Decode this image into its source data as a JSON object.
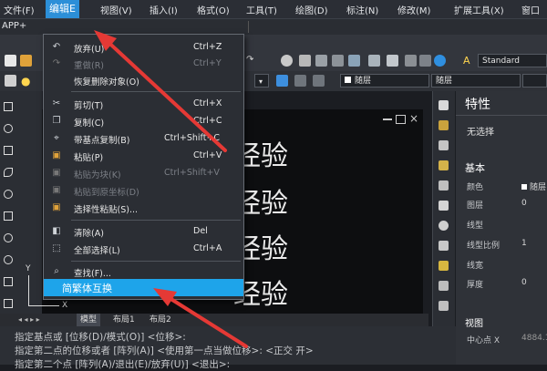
{
  "menubar": {
    "items": [
      "文件(F)",
      "编辑E",
      "视图(V)",
      "插入(I)",
      "格式(O)",
      "工具(T)",
      "绘图(D)",
      "标注(N)",
      "修改(M)",
      "扩展工具(X)",
      "窗口"
    ]
  },
  "app_label": "APP+",
  "toolbar": {
    "text_style": "Standard",
    "layer": "随层",
    "linetype": "随层"
  },
  "edit_menu": {
    "items": [
      {
        "label": "放弃(U)",
        "shortcut": "Ctrl+Z",
        "icon": "undo-icon",
        "disabled": false
      },
      {
        "label": "重做(R)",
        "shortcut": "Ctrl+Y",
        "icon": "redo-icon",
        "disabled": true
      },
      {
        "label": "恢复删除对象(O)",
        "shortcut": "",
        "icon": "",
        "disabled": false
      },
      {
        "label": "剪切(T)",
        "shortcut": "Ctrl+X",
        "icon": "scissors-icon",
        "disabled": false
      },
      {
        "label": "复制(C)",
        "shortcut": "Ctrl+C",
        "icon": "copy-icon",
        "disabled": false
      },
      {
        "label": "带基点复制(B)",
        "shortcut": "Ctrl+Shift+C",
        "icon": "copy-base-icon",
        "disabled": false
      },
      {
        "label": "粘贴(P)",
        "shortcut": "Ctrl+V",
        "icon": "paste-icon",
        "disabled": false
      },
      {
        "label": "粘贴为块(K)",
        "shortcut": "Ctrl+Shift+V",
        "icon": "paste-block-icon",
        "disabled": true
      },
      {
        "label": "粘贴到原坐标(D)",
        "shortcut": "",
        "icon": "paste-original-icon",
        "disabled": true
      },
      {
        "label": "选择性粘贴(S)...",
        "shortcut": "",
        "icon": "paste-special-icon",
        "disabled": false
      },
      {
        "label": "清除(A)",
        "shortcut": "Del",
        "icon": "eraser-icon",
        "disabled": false
      },
      {
        "label": "全部选择(L)",
        "shortcut": "Ctrl+A",
        "icon": "select-all-icon",
        "disabled": false
      },
      {
        "label": "查找(F)...",
        "shortcut": "",
        "icon": "find-icon",
        "disabled": false
      },
      {
        "label": "简繁体互换",
        "shortcut": "",
        "icon": "",
        "disabled": false
      }
    ]
  },
  "canvas": {
    "texts": [
      "经验",
      "经验",
      "经验",
      "经验"
    ]
  },
  "layout_tabs": [
    "模型",
    "布局1",
    "布局2"
  ],
  "command_lines": [
    "指定基点或 [位移(D)/模式(O)] <位移>:",
    "指定第二点的位移或者 [阵列(A)] <使用第一点当做位移>: <正交 开>",
    "指定第二个点 [阵列(A)/退出(E)/放弃(U)] <退出>:"
  ],
  "properties": {
    "title": "特性",
    "selection": "无选择",
    "basic_header": "基本",
    "rows": [
      {
        "label": "颜色",
        "value": "随层"
      },
      {
        "label": "图层",
        "value": "0"
      },
      {
        "label": "线型",
        "value": ""
      },
      {
        "label": "线型比例",
        "value": "1"
      },
      {
        "label": "线宽",
        "value": ""
      },
      {
        "label": "厚度",
        "value": "0"
      }
    ],
    "view_header": "视图",
    "view_rows": [
      {
        "label": "中心点 X",
        "value": "4884.1"
      }
    ]
  },
  "ucs": {
    "y": "Y",
    "x": "X"
  },
  "colors": {
    "accent": "#1ea4ea",
    "menu_bg": "#2b2e34",
    "arrow": "#e53935"
  }
}
